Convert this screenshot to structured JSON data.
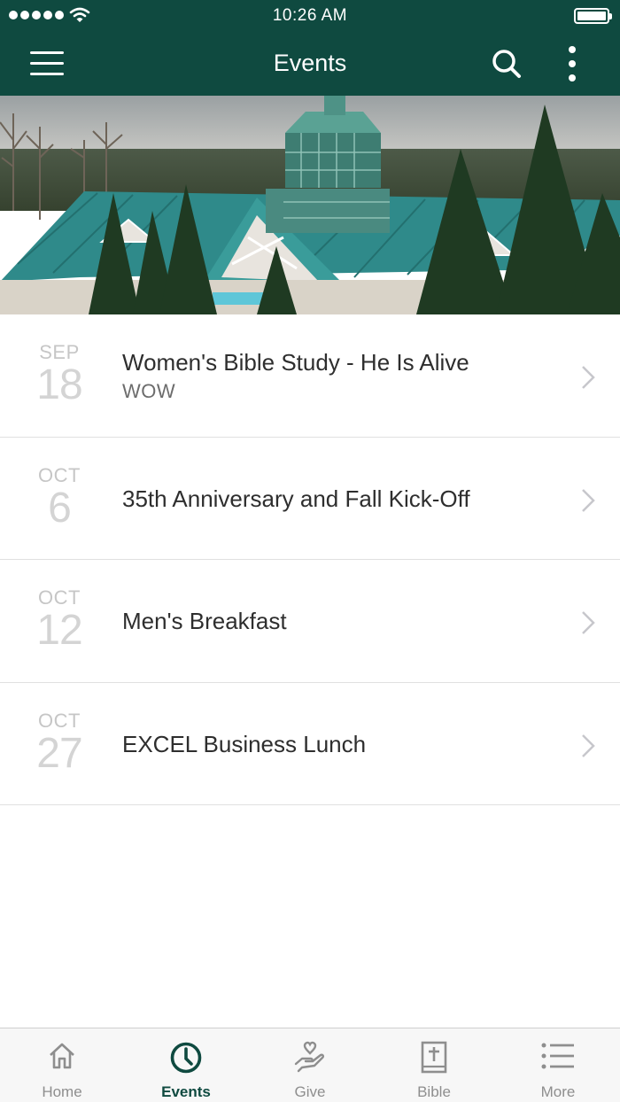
{
  "status_bar": {
    "time": "10:26 AM"
  },
  "header": {
    "title": "Events"
  },
  "events": [
    {
      "month": "SEP",
      "day": "18",
      "title": "Women's Bible Study - He Is Alive",
      "subtitle": "WOW"
    },
    {
      "month": "OCT",
      "day": "6",
      "title": "35th Anniversary and Fall Kick-Off",
      "subtitle": ""
    },
    {
      "month": "OCT",
      "day": "12",
      "title": "Men's Breakfast",
      "subtitle": ""
    },
    {
      "month": "OCT",
      "day": "27",
      "title": "EXCEL Business Lunch",
      "subtitle": ""
    }
  ],
  "tabs": [
    {
      "label": "Home",
      "icon": "home-icon",
      "active": false
    },
    {
      "label": "Events",
      "icon": "clock-icon",
      "active": true
    },
    {
      "label": "Give",
      "icon": "heart-hand-icon",
      "active": false
    },
    {
      "label": "Bible",
      "icon": "bible-icon",
      "active": false
    },
    {
      "label": "More",
      "icon": "list-icon",
      "active": false
    }
  ],
  "colors": {
    "brand": "#0f4a40",
    "tab_inactive": "#8e8e8e",
    "roof": "#2f8a8a"
  }
}
